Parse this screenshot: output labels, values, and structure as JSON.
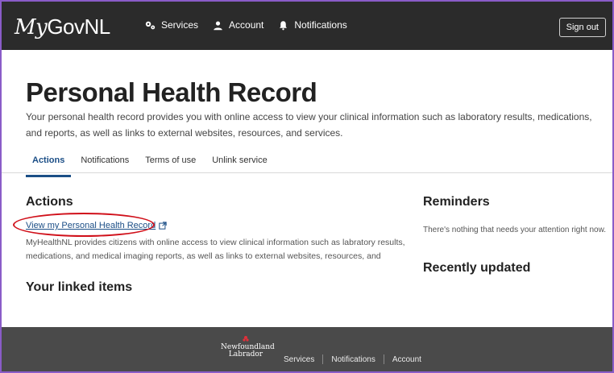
{
  "header": {
    "logo_my": "My",
    "logo_gov": "GovNL",
    "nav": [
      {
        "label": "Services",
        "icon": "gears-icon"
      },
      {
        "label": "Account",
        "icon": "person-icon"
      },
      {
        "label": "Notifications",
        "icon": "bell-icon"
      }
    ],
    "sign_out": "Sign out"
  },
  "page": {
    "title": "Personal Health Record",
    "intro": "Your personal health record provides you with online access to view your clinical information such as laboratory results, medications, and reports, as well as links to external websites, resources, and services."
  },
  "tabs": [
    {
      "label": "Actions",
      "active": true
    },
    {
      "label": "Notifications",
      "active": false
    },
    {
      "label": "Terms of use",
      "active": false
    },
    {
      "label": "Unlink service",
      "active": false
    }
  ],
  "actions": {
    "heading": "Actions",
    "link_label": "View my Personal Health Record",
    "description": "MyHealthNL provides citizens with online access to view clinical information such as labratory results, medications, and medical imaging reports, as well as links to external websites, resources, and"
  },
  "linked_items": {
    "heading": "Your linked items"
  },
  "reminders": {
    "heading": "Reminders",
    "empty_text": "There's nothing that needs your attention right now."
  },
  "recently_updated": {
    "heading": "Recently updated"
  },
  "footer": {
    "logo_line1": "Newfoundland",
    "logo_line2": "Labrador",
    "links": [
      "Services",
      "Notifications",
      "Account"
    ]
  },
  "colors": {
    "topbar": "#2b2b2b",
    "footer": "#4a4a4a",
    "link": "#1b4e86",
    "highlight_circle": "#d0101a",
    "frame_border": "#8a5cc8"
  }
}
